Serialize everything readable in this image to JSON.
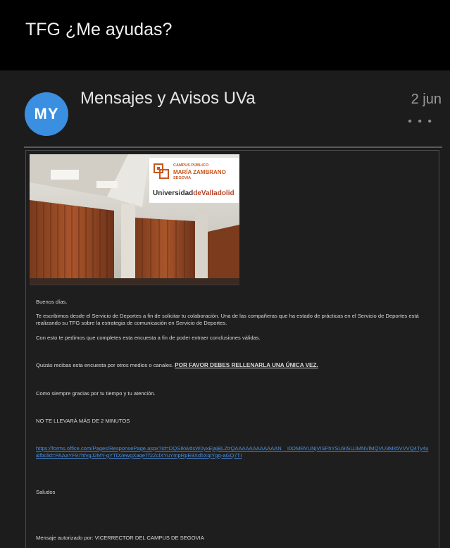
{
  "header": {
    "title": "TFG ¿Me ayudas?"
  },
  "message": {
    "avatar_initials": "MY",
    "sender": "Mensajes y Avisos UVa",
    "date": "2 jun",
    "more_icon": "ellipsis-icon",
    "more_glyph": "• • •"
  },
  "banner": {
    "campus_line": "CAMPUS PÚBLICO",
    "name_line": "MARÍA ZAMBRANO",
    "city_line": "SEGOVIA",
    "uni_left": "Universidad",
    "uni_de": "de",
    "uni_right": "Valladolid"
  },
  "email": {
    "greeting": "Buenos días.",
    "para1": "Te escribimos desde el Servicio de Deportes a fin de solicitar tu colaboración. Una de las compañeras que ha estado de prácticas en el Servicio de Deportes está realizando su TFG sobre la estrategia de comunicación en Servicio de Deportes.",
    "para2": "Con esto te pedimos que completes esta encuesta a fin de poder extraer conclusiones válidas.",
    "para3_lead": "Quizás recibas esta encuesta por otros medios o canales.",
    "para3_emph": "POR FAVOR DEBES RELLENARLA UNA ÚNICA VEZ.",
    "para4": "Como siempre gracias por tu tiempo y tu atención.",
    "para5": "NO TE LLEVARÁ MÁS DE 2 MINUTOS",
    "link": "https://forms.office.com/Pages/ResponsePage.aspx?id=DQSIkWdsW0yxEjajBLZtrQAAAAAAAAAAAAN__i0OMRVUNjVISFhYSU9ISUJMNVlMQVU3Mk5VVVQ4Ty4u&fbclid=PAAaYF97hfvgJ2MY-gYTD2ewgXaqeTf2ZclXYuYmpRpE9Xd5XqiYgq-aGQ7TI",
    "sign_off": "Saludos",
    "footer": "Mensaje autorizado por: VICERRECTOR DEL CAMPUS DE SEGOVIA"
  }
}
